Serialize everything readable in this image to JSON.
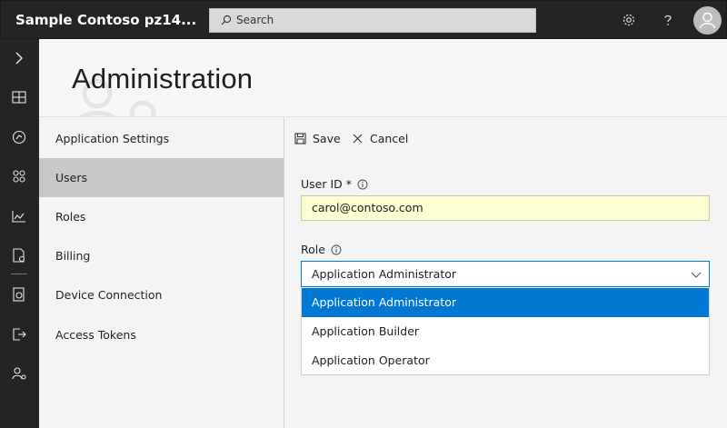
{
  "topbar": {
    "app_title": "Sample Contoso pz14...",
    "search_placeholder": "Search",
    "icons": [
      "gear-icon",
      "help-icon",
      "avatar-icon"
    ]
  },
  "leftnav": {
    "icons": [
      "chevron-right-icon",
      "dashboard-icon",
      "devices-icon",
      "device-groups-icon",
      "analytics-icon",
      "jobs-icon",
      "device-templates-icon",
      "data-export-icon",
      "administration-icon"
    ]
  },
  "header": {
    "title": "Administration"
  },
  "settings_nav": {
    "items": [
      {
        "label": "Application Settings"
      },
      {
        "label": "Users"
      },
      {
        "label": "Roles"
      },
      {
        "label": "Billing"
      },
      {
        "label": "Device Connection"
      },
      {
        "label": "Access Tokens"
      }
    ],
    "selected": "Users"
  },
  "toolbar": {
    "save_label": "Save",
    "cancel_label": "Cancel"
  },
  "form": {
    "user_id_label": "User ID *",
    "user_id_value": "carol@contoso.com",
    "role_label": "Role",
    "role_value": "Application Administrator",
    "role_options": [
      {
        "label": "Application Administrator"
      },
      {
        "label": "Application Builder"
      },
      {
        "label": "Application Operator"
      }
    ]
  },
  "colors": {
    "topbar_bg": "#242424",
    "accent": "#0078d4",
    "input_highlight": "#fcfdd0",
    "selected_nav": "#c8c8c8"
  }
}
